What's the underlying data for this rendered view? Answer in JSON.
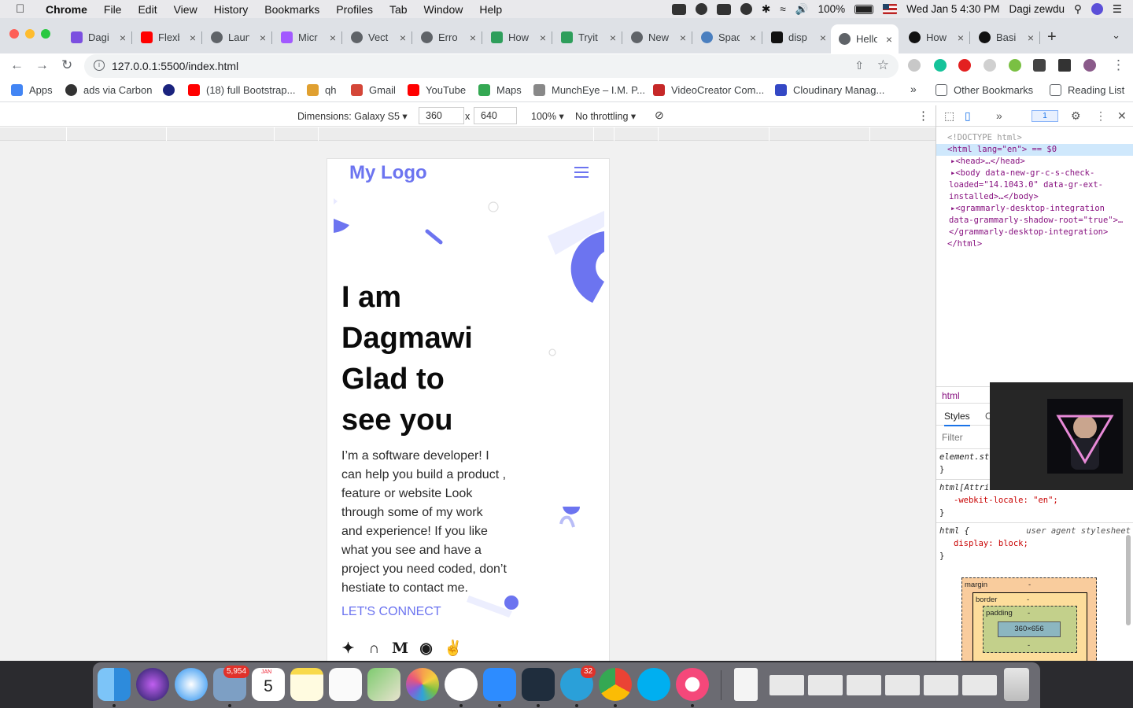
{
  "menubar": {
    "app": "Chrome",
    "items": [
      "File",
      "Edit",
      "View",
      "History",
      "Bookmarks",
      "Profiles",
      "Tab",
      "Window",
      "Help"
    ],
    "battery": "100%",
    "datetime": "Wed Jan 5  4:30 PM",
    "user": "Dagi zewdu"
  },
  "tabs": [
    {
      "title": "Dagi",
      "icon": "tab-favicon",
      "color": "#7b4fe0"
    },
    {
      "title": "Flexb",
      "icon": "youtube-icon",
      "color": "#ff0000"
    },
    {
      "title": "Laun",
      "icon": "globe-icon",
      "color": "#5f6368"
    },
    {
      "title": "Micr",
      "icon": "figma-icon",
      "color": "#a259ff"
    },
    {
      "title": "Vect",
      "icon": "globe-icon",
      "color": "#5f6368"
    },
    {
      "title": "Erro",
      "icon": "globe-icon",
      "color": "#5f6368"
    },
    {
      "title": "How",
      "icon": "w-icon",
      "color": "#2e9e5b"
    },
    {
      "title": "Tryit",
      "icon": "w-icon",
      "color": "#2e9e5b"
    },
    {
      "title": "New",
      "icon": "chrome-icon",
      "color": "#5f6368"
    },
    {
      "title": "Spac",
      "icon": "earth-icon",
      "color": "#4a7fbf"
    },
    {
      "title": "disp",
      "icon": "square-icon",
      "color": "#111111"
    },
    {
      "title": "Hello",
      "icon": "globe-icon",
      "color": "#5f6368",
      "active": true
    },
    {
      "title": "How",
      "icon": "github-icon",
      "color": "#111111"
    },
    {
      "title": "Basi",
      "icon": "github-icon",
      "color": "#111111"
    }
  ],
  "toolbar": {
    "url": "127.0.0.1:5500/index.html"
  },
  "bookmarks": {
    "items": [
      {
        "label": "Apps",
        "color": "#4285f4"
      },
      {
        "label": "ads via Carbon",
        "color": "#333333"
      },
      {
        "label": "",
        "color": "#1a237e"
      },
      {
        "label": "(18) full Bootstrap...",
        "color": "#ff0000"
      },
      {
        "label": "qh",
        "color": "#e0a030"
      },
      {
        "label": "Gmail",
        "color": "#d44638"
      },
      {
        "label": "YouTube",
        "color": "#ff0000"
      },
      {
        "label": "Maps",
        "color": "#34a853"
      },
      {
        "label": "MunchEye – I.M. P...",
        "color": "#888888"
      },
      {
        "label": "VideoCreator Com...",
        "color": "#c62828"
      },
      {
        "label": "Cloudinary Manag...",
        "color": "#3448c5"
      }
    ],
    "more": "»",
    "other": "Other Bookmarks",
    "reading": "Reading List"
  },
  "device_toolbar": {
    "dimensions": "Dimensions: Galaxy S5 ▾",
    "width": "360",
    "times": "x",
    "height": "640",
    "zoom": "100% ▾",
    "throttle": "No throttling ▾"
  },
  "site": {
    "logo": "My Logo",
    "title_lines": [
      "I am",
      "Dagmawi",
      "Glad to",
      "see you"
    ],
    "description": "I’m a software developer! I can help you build a product , feature or website Look through some of my work and experience! If you like what you see and have a project you need coded, don’t hestiate to contact me.",
    "cta": "LET'S CONNECT",
    "accent": "#6c74f0"
  },
  "devtools": {
    "issues": "1",
    "dom": {
      "doctype": "<!DOCTYPE html>",
      "html_open": "<html lang=\"en\"> == $0",
      "head": "▸<head>…</head>",
      "body1": "▸<body data-new-gr-c-s-check-",
      "body2": "loaded=\"14.1043.0\" data-gr-ext-",
      "body3": "installed>…</body>",
      "gram1": "▸<grammarly-desktop-integration",
      "gram2": "data-grammarly-shadow-root=\"true\">…",
      "gram3": "</grammarly-desktop-integration>",
      "html_close": "</html>"
    },
    "crumb": "html",
    "tabs": [
      "Styles",
      "C"
    ],
    "filter_placeholder": "Filter",
    "rules": {
      "r1_sel": "element.st",
      "r1_close": "}",
      "r2_sel": "html[Attri",
      "r2_prop": "-webkit-locale: \"en\";",
      "r2_close": "}",
      "r3_sel": "html {",
      "r3_src": "user agent stylesheet",
      "r3_prop": "display: block;",
      "r3_close": "}"
    },
    "boxmodel": {
      "margin": "margin",
      "border": "border",
      "padding": "padding",
      "content": "360×656",
      "dash": "-"
    }
  },
  "dock": {
    "badges": {
      "mail": "5,954",
      "telegram": "32"
    },
    "calendar": {
      "month": "JAN",
      "day": "5"
    }
  }
}
